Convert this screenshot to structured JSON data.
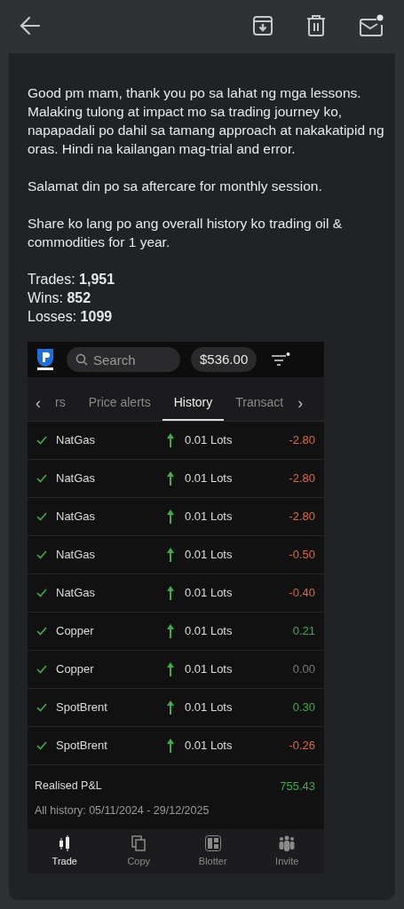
{
  "message": {
    "paragraphs": [
      "Good pm mam, thank you po sa lahat ng mga lessons. Malaking tulong at impact mo sa trading journey ko, napapadali po dahil sa tamang approach at nakakatipid ng oras. Hindi na kailangan mag-trial and error.",
      "Salamat din po sa aftercare for monthly session.",
      "Share ko lang po ang overall history ko trading oil & commodities for 1 year."
    ],
    "stats": [
      "Trades: **1,951**",
      "Wins: **852**",
      "Losses: **1099**"
    ]
  },
  "app": {
    "search": {
      "placeholder": "Search"
    },
    "balance": "$536.00",
    "scroll_left": "‹",
    "scroll_right": "›",
    "tabs": [
      {
        "label": "rs",
        "selected": false
      },
      {
        "label": "Price alerts",
        "selected": false
      },
      {
        "label": "History",
        "selected": true
      },
      {
        "label": "Transact",
        "selected": false
      }
    ],
    "trades": [
      {
        "symbol": "NatGas",
        "volume": "0.01 Lots",
        "pnl": "-2.80",
        "color": "#e0673a"
      },
      {
        "symbol": "NatGas",
        "volume": "0.01 Lots",
        "pnl": "-2.80",
        "color": "#e0673a"
      },
      {
        "symbol": "NatGas",
        "volume": "0.01 Lots",
        "pnl": "-2.80",
        "color": "#e0673a"
      },
      {
        "symbol": "NatGas",
        "volume": "0.01 Lots",
        "pnl": "-0.50",
        "color": "#e0673a"
      },
      {
        "symbol": "NatGas",
        "volume": "0.01 Lots",
        "pnl": "-0.40",
        "color": "#e0673a"
      },
      {
        "symbol": "Copper",
        "volume": "0.01 Lots",
        "pnl": "0.21",
        "color": "#3fae4a"
      },
      {
        "symbol": "Copper",
        "volume": "0.01 Lots",
        "pnl": "0.00",
        "color": "#7a7a7a"
      },
      {
        "symbol": "SpotBrent",
        "volume": "0.01 Lots",
        "pnl": "0.30",
        "color": "#3fae4a"
      },
      {
        "symbol": "SpotBrent",
        "volume": "0.01 Lots",
        "pnl": "-0.26",
        "color": "#e0673a"
      }
    ],
    "summary": {
      "label": "Realised P&L",
      "value": "755.43",
      "range": "All history: 05/11/2024 - 29/12/2025"
    },
    "nav": [
      {
        "label": "Trade",
        "kind": "trade",
        "selected": true
      },
      {
        "label": "Copy",
        "kind": "copy",
        "selected": false
      },
      {
        "label": "Blotter",
        "kind": "blotter",
        "selected": false
      },
      {
        "label": "Invite",
        "kind": "invite",
        "selected": false
      }
    ]
  }
}
